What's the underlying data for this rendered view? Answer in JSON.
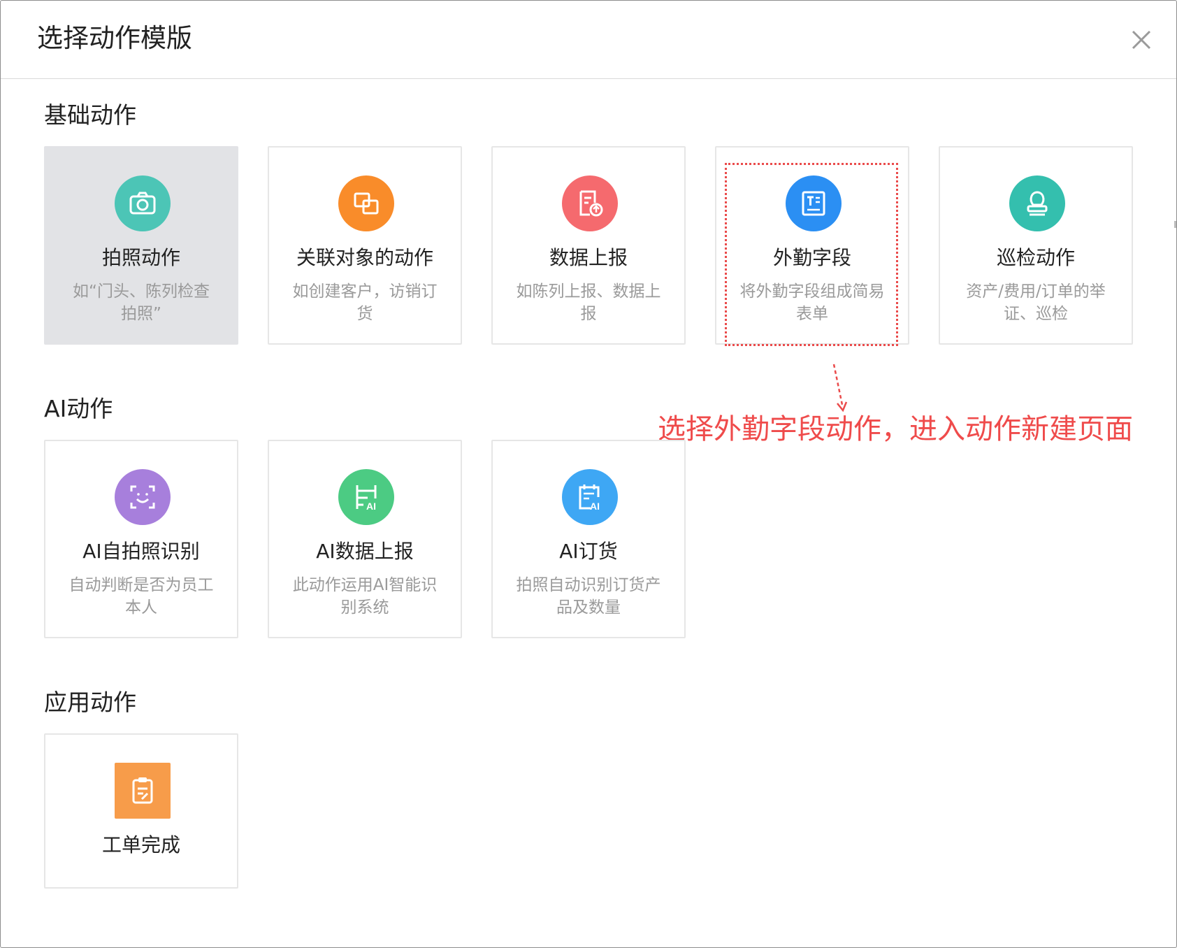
{
  "dialog": {
    "title": "选择动作模版"
  },
  "sections": {
    "basic": {
      "title": "基础动作",
      "cards": [
        {
          "title": "拍照动作",
          "desc": "如“门头、陈列检查拍照”",
          "icon": "camera-icon",
          "color": "#4cc5b6"
        },
        {
          "title": "关联对象的动作",
          "desc": "如创建客户，访销订货",
          "icon": "link-object-icon",
          "color": "#f98c2a"
        },
        {
          "title": "数据上报",
          "desc": "如陈列上报、数据上报",
          "icon": "data-report-icon",
          "color": "#f56a6e"
        },
        {
          "title": "外勤字段",
          "desc": "将外勤字段组成简易表单",
          "icon": "field-form-icon",
          "color": "#2b8ff3"
        },
        {
          "title": "巡检动作",
          "desc": "资产/费用/订单的举证、巡检",
          "icon": "stamp-icon",
          "color": "#34bfae"
        }
      ]
    },
    "ai": {
      "title": "AI动作",
      "cards": [
        {
          "title": "AI自拍照识别",
          "desc": "自动判断是否为员工本人",
          "icon": "face-scan-icon",
          "color": "#a77fdc"
        },
        {
          "title": "AI数据上报",
          "desc": "此动作运用AI智能识别系统",
          "icon": "ai-shelf-icon",
          "color": "#4ccb83"
        },
        {
          "title": "AI订货",
          "desc": "拍照自动识别订货产品及数量",
          "icon": "ai-order-icon",
          "color": "#3ea7f4"
        }
      ]
    },
    "app": {
      "title": "应用动作",
      "cards": [
        {
          "title": "工单完成",
          "desc": "",
          "icon": "clipboard-icon",
          "color": "#f79c4a"
        }
      ]
    }
  },
  "annotation": {
    "text": "选择外勤字段动作，进入动作新建页面",
    "color": "#ef4b4b"
  }
}
